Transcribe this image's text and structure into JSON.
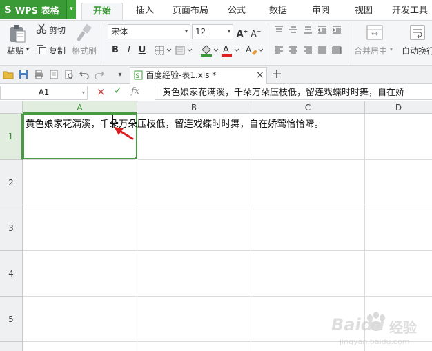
{
  "app": {
    "logo": "S",
    "title": "WPS 表格",
    "caret": "▾"
  },
  "menu": {
    "tabs": [
      "开始",
      "插入",
      "页面布局",
      "公式",
      "数据",
      "审阅",
      "视图",
      "开发工具"
    ],
    "active_index": 0
  },
  "ribbon": {
    "paste": "粘贴",
    "cut": "剪切",
    "copy": "复制",
    "format_painter": "格式刷",
    "font_name": "宋体",
    "font_size": "12",
    "bold": "B",
    "italic": "I",
    "underline": "U",
    "merge_center": "合并居中",
    "wrap_text": "自动换行",
    "dropdown_caret": "▾"
  },
  "tabbar": {
    "doc_name": "百度经验-表1.xls *",
    "close": "×",
    "new_tab": "+"
  },
  "formula_bar": {
    "cell_ref": "A1",
    "fx": "fx",
    "cancel": "×",
    "confirm": "✓",
    "content": "黄色娘家花满溪，千朵万朵压枝低，留连戏蝶时时舞，自在娇"
  },
  "grid": {
    "columns": [
      "A",
      "B",
      "C",
      "D"
    ],
    "rows": [
      "1",
      "2",
      "3",
      "4",
      "5"
    ],
    "selected_cell": "A1",
    "cell_a1": "黄色娘家花满溪，千朵万朵压枝低，留连戏蝶时时舞，自在娇莺恰恰啼。"
  },
  "watermark": {
    "brand": "Baidu",
    "sub": "经验",
    "url": "jingyan.baidu.com"
  },
  "colors": {
    "accent": "#3a9a35",
    "arrow": "#d81e1e"
  }
}
